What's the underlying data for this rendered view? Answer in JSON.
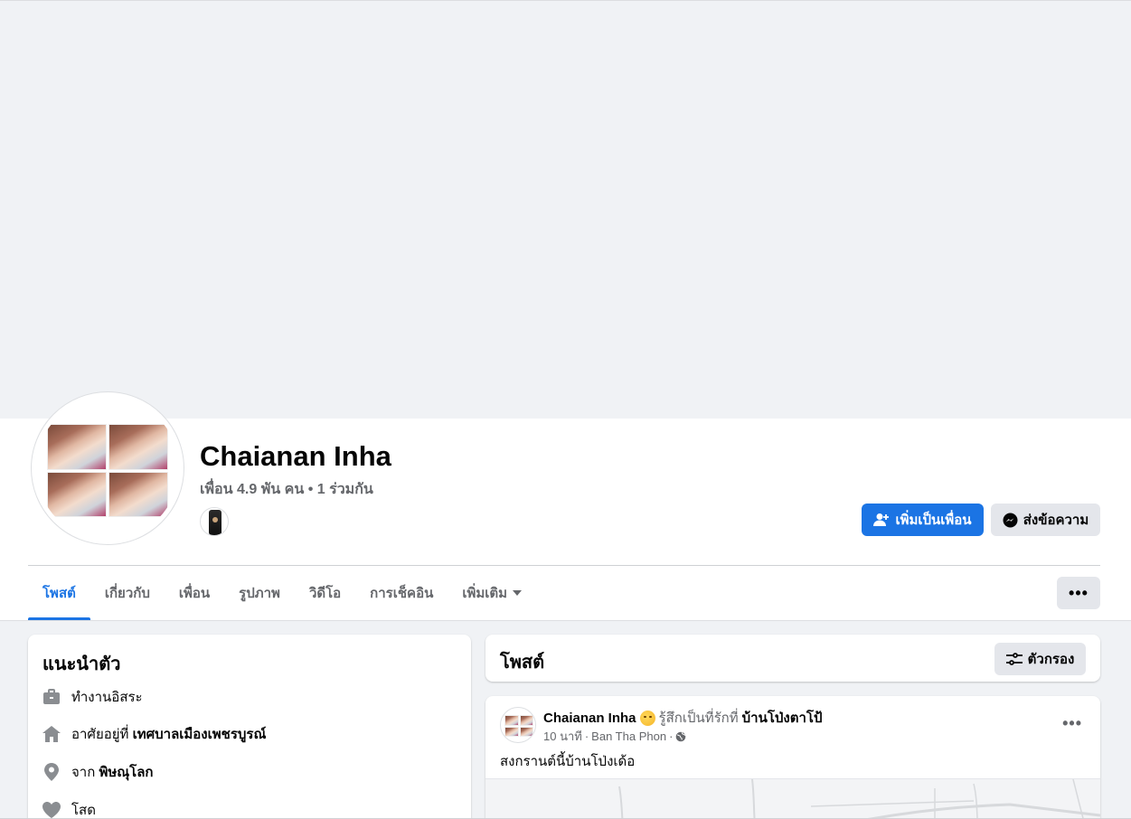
{
  "profile": {
    "name": "Chaianan Inha",
    "friends_line": "เพื่อน 4.9 พัน คน • 1 ร่วมกัน"
  },
  "actions": {
    "add_friend": "เพิ่มเป็นเพื่อน",
    "message": "ส่งข้อความ",
    "more": "•••"
  },
  "tabs": [
    {
      "label": "โพสต์",
      "active": true
    },
    {
      "label": "เกี่ยวกับ"
    },
    {
      "label": "เพื่อน"
    },
    {
      "label": "รูปภาพ"
    },
    {
      "label": "วิดีโอ"
    },
    {
      "label": "การเช็คอิน"
    },
    {
      "label": "เพิ่มเติม"
    }
  ],
  "intro": {
    "title": "แนะนำตัว",
    "work": "ทำงานอิสระ",
    "lives_prefix": "อาศัยอยู่ที่",
    "lives_place": "เทศบาลเมืองเพชรบูรณ์",
    "from_prefix": "จาก",
    "from_place": "พิษณุโลก",
    "relationship": "โสด"
  },
  "posts_section": {
    "title": "โพสต์",
    "filter": "ตัวกรอง"
  },
  "post": {
    "author": "Chaianan Inha",
    "feeling": "รู้สึกเป็นที่รักที่",
    "place": "บ้านโป่งตาโป้",
    "time": "10 นาที",
    "location": "Ban Tha Phon",
    "separator": "·",
    "text": "สงกรานต์นี้บ้านโป่งเด้อ",
    "more": "•••"
  },
  "colors": {
    "accent": "#1b74e4",
    "background": "#f0f2f5",
    "secondary_text": "#65676b"
  }
}
